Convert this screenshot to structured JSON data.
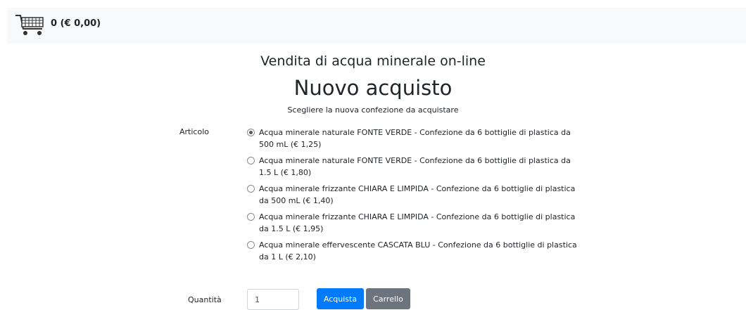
{
  "header": {
    "cart_summary": "0 (€ 0,00)",
    "cart_icon": "shopping-cart-icon"
  },
  "page": {
    "subtitle": "Vendita di acqua minerale on-line",
    "title": "Nuovo acquisto",
    "instructions": "Scegliere la nuova confezione da acquistare"
  },
  "form": {
    "articolo_label": "Articolo",
    "options": [
      {
        "label": "Acqua minerale naturale FONTE VERDE - Confezione da 6 bottiglie di plastica da 500 mL (€ 1,25)",
        "selected": true
      },
      {
        "label": "Acqua minerale naturale FONTE VERDE - Confezione da 6 bottiglie di plastica da 1.5 L (€ 1,80)",
        "selected": false
      },
      {
        "label": "Acqua minerale frizzante CHIARA E LIMPIDA - Confezione da 6 bottiglie di plastica da 500 mL (€ 1,40)",
        "selected": false
      },
      {
        "label": "Acqua minerale frizzante CHIARA E LIMPIDA - Confezione da 6 bottiglie di plastica da 1.5 L (€ 1,95)",
        "selected": false
      },
      {
        "label": "Acqua minerale effervescente CASCATA BLU - Confezione da 6 bottiglie di plastica da 1 L (€ 2,10)",
        "selected": false
      }
    ],
    "quantita_label": "Quantità",
    "quantity_value": "1",
    "buy_label": "Acquista",
    "cart_label": "Carrello"
  },
  "colors": {
    "primary": "#007bff",
    "secondary": "#6c757d",
    "topbar_bg": "#f8f9fa"
  }
}
